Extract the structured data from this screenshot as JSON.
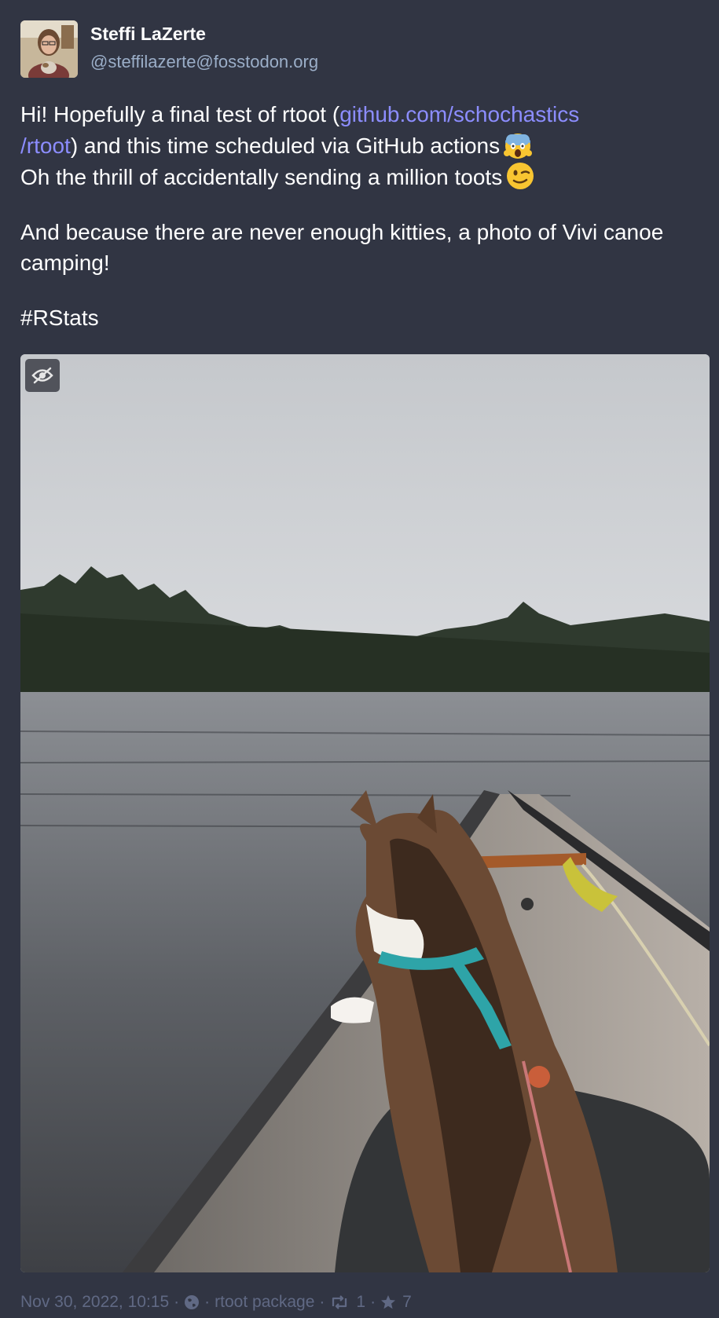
{
  "author": {
    "display_name": "Steffi LaZerte",
    "handle": "@steffilazerte@fosstodon.org"
  },
  "post": {
    "p1_text_a": "Hi! Hopefully a final test of rtoot (",
    "p1_link_line1": "github.com/schochastics",
    "p1_link_line2": "/rtoot",
    "p1_text_b": ") and this time scheduled via GitHub actions",
    "p1_emoji_1": "scream-emoji",
    "p1_text_c": "Oh the thrill of accidentally sending a million toots",
    "p1_emoji_2": "wink-emoji",
    "p2_text": "And because there are never enough kitties, a photo of Vivi canoe camping!",
    "hashtag": "#RStats",
    "link_color": "#8c8dff"
  },
  "media": {
    "type": "photo",
    "hide_button_icon": "eye-slash-icon"
  },
  "footer": {
    "timestamp": "Nov 30, 2022, 10:15",
    "visibility_icon": "globe-icon",
    "application": "rtoot package",
    "boost_icon": "retweet-icon",
    "boosts": "1",
    "favourite_icon": "star-icon",
    "favourites": "7",
    "separator": "·"
  }
}
